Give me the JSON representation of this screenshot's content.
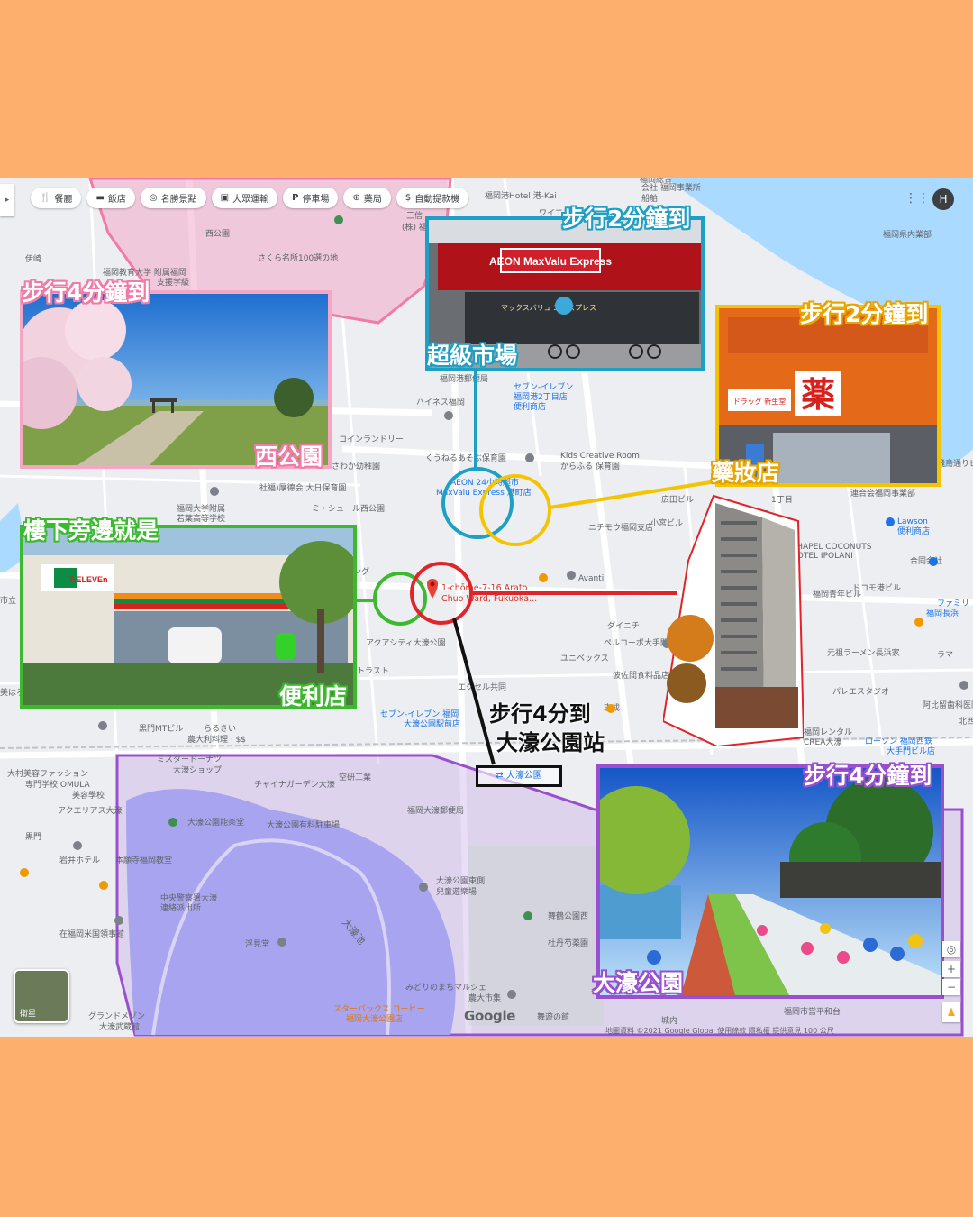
{
  "map": {
    "filter_chips": [
      {
        "icon": "restaurant-icon",
        "glyph": "🍴",
        "label": "餐廳"
      },
      {
        "icon": "hotel-icon",
        "glyph": "▬",
        "label": "飯店"
      },
      {
        "icon": "attraction-icon",
        "glyph": "◎",
        "label": "名勝景點"
      },
      {
        "icon": "transit-icon",
        "glyph": "▣",
        "label": "大眾運輸"
      },
      {
        "icon": "parking-icon",
        "glyph": "P",
        "label": "停車場"
      },
      {
        "icon": "pharmacy-icon",
        "glyph": "⊕",
        "label": "藥局"
      },
      {
        "icon": "atm-icon",
        "glyph": "$",
        "label": "自動提款機"
      }
    ],
    "account_initial": "H",
    "pin_address": [
      "1-chōme-7-16 Arato",
      "Chuo Ward, Fukuoka..."
    ],
    "station_label": "大濠公園",
    "satellite_label": "衛星",
    "google_logo": "Google",
    "footer": "地圖資料 ©2021 Google   Global   使用條款   隱私權   提供意見   100 公尺",
    "place_labels": [
      "西公園",
      "さくら名所100選の地",
      "福岡教育大学 附属福岡",
      "支援学級",
      "伊崎",
      "三信",
      "(株) 福岡",
      "福岡港郵便局",
      "セブン-イレブン",
      "福岡港2丁目店",
      "便利商店",
      "ハイネス福岡",
      "コインランドリー",
      "さわか幼稚園",
      "くうねるあそぶ保育園",
      "Kids Creative Room",
      "からふる 保育園",
      "社福)厚德会 大日保育園",
      "ミ・シュール西公園",
      "福岡大学附属",
      "若葉高等学校",
      "AEON 24小時超市",
      "MaxValu Express 港町店",
      "ニチモウ福岡支店",
      "小宮ビル",
      "Lawson",
      "便利商店",
      "CHAPEL COCONUTS",
      "HOTEL IPOLANI",
      "ドコモ港ビル",
      "福岡青年ビル",
      "ファミリ",
      "福岡長浜",
      "Avanti",
      "ダイニチ",
      "ペルコーポ大手門",
      "ユニベックス",
      "波佐間食料品店",
      "元祖ラーメン長浜家",
      "アクアシティ大濠公園",
      "トラスト",
      "エクセル共同",
      "志成",
      "セブン-イレブン 福岡",
      "大濠公園駅前店",
      "福岡レンタル",
      "CREA大濠",
      "ローソン 福岡西鉄",
      "大手門ビル店",
      "らるきい",
      "農大利料理 · $$",
      "黒門MTビル",
      "大村美容ファッション",
      "専門学校 OMULA",
      "美容學校",
      "ミスタードーナツ",
      "大濠ショップ",
      "チャイナガーデン大濠",
      "空研工業",
      "アクエリアス大濠",
      "大濠公園能楽堂",
      "大濠公園有料駐車場",
      "福岡大濠郵便局",
      "黒門",
      "岩井ホテル",
      "本願寺福岡教堂",
      "中央警察署大濠",
      "連絡派出所",
      "大濠公園東側",
      "兒童遊樂場",
      "大濠池",
      "浮見堂",
      "舞鶴公園西",
      "杜丹芍薬園",
      "在福岡米国領事館",
      "みどりのまちマルシェ",
      "農大市集",
      "スターバックス コーヒー",
      "福岡大濠公園店",
      "舞遊の館",
      "福岡市営平和台",
      "グランドメゾン",
      "大濠武蔵館",
      "城内",
      "会社 福岡事業所",
      "船舶",
      "福岡港Hotel 港-Kai",
      "福岡総合",
      "ワイエ",
      "福岡県内業部",
      "パレエスタジオ",
      "阿比留歯科医院",
      "北西",
      "飛鳥通りビル",
      "連合会福岡事業部",
      "合同会社",
      "ラマ",
      "ング",
      "市立",
      "美はろ",
      "広田ビル",
      "1丁目"
    ]
  },
  "callouts": {
    "west_park": {
      "walk": "步行4分鐘到",
      "name": "西公園"
    },
    "supermarket": {
      "walk": "步行2分鐘到",
      "name": "超級市場"
    },
    "drugstore": {
      "walk": "步行2分鐘到",
      "name": "藥妝店"
    },
    "convenience": {
      "walk": "樓下旁邊就是",
      "name": "便利店"
    },
    "station": {
      "walk": "步行4分到",
      "name": "大濠公園站"
    },
    "ohori_park": {
      "walk": "步行4分鐘到",
      "name": "大濠公園"
    }
  },
  "photo_text": {
    "maxvalu_sign": "AEON MaxValu Express",
    "maxvalu_sub": "マックスバリュ エクスプレス",
    "drug_sign": "薬",
    "drug_sub": "ドラッグ 新生堂",
    "seven_sign": "7-ELEVEn"
  },
  "colors": {
    "background": "#fdb06e",
    "pink": "#f27aa6",
    "blue": "#1e9fc4",
    "gold": "#f5c400",
    "green": "#3cb92e",
    "red": "#e0242a",
    "purple": "#9a4fcf",
    "water": "#aadaff"
  }
}
